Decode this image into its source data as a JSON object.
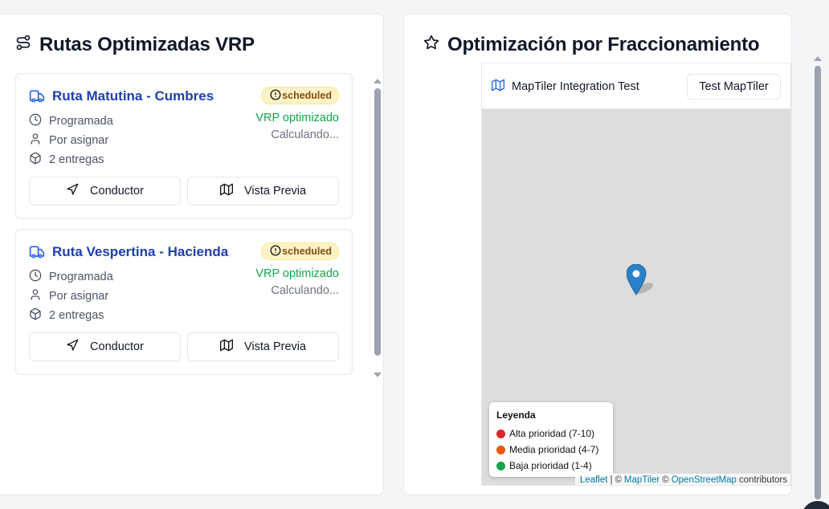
{
  "left_panel": {
    "title": "Rutas Optimizadas VRP",
    "title_icon": "route-icon",
    "routes": [
      {
        "name": "Ruta Matutina - Cumbres",
        "status": "scheduled",
        "schedule": "Programada",
        "driver": "Por asignar",
        "deliveries": "2 entregas",
        "vrp": "VRP optimizado",
        "calc": "Calculando...",
        "conductor_label": "Conductor",
        "preview_label": "Vista Previa"
      },
      {
        "name": "Ruta Vespertina - Hacienda",
        "status": "scheduled",
        "schedule": "Programada",
        "driver": "Por asignar",
        "deliveries": "2 entregas",
        "vrp": "VRP optimizado",
        "calc": "Calculando...",
        "conductor_label": "Conductor",
        "preview_label": "Vista Previa"
      }
    ]
  },
  "right_panel": {
    "title": "Optimización por Fraccionamiento",
    "title_icon": "star-icon",
    "map": {
      "header_title": "MapTiler Integration Test",
      "test_button": "Test MapTiler",
      "legend": {
        "title": "Leyenda",
        "items": [
          {
            "label": "Alta prioridad (7-10)",
            "color": "#dc2626"
          },
          {
            "label": "Media prioridad (4-7)",
            "color": "#ea580c"
          },
          {
            "label": "Baja prioridad (1-4)",
            "color": "#16a34a"
          }
        ]
      },
      "attribution": {
        "leaflet": "Leaflet",
        "sep1": "|",
        "copy1": "©",
        "maptiler": "MapTiler",
        "copy2": "©",
        "osm": "OpenStreetMap",
        "contributors": "contributors"
      },
      "marker_color": "#2a81cb"
    }
  },
  "colors": {
    "route_title": "#1e40af",
    "vrp_green": "#16a34a",
    "badge_bg": "#fef3c7",
    "badge_text": "#854d0e"
  }
}
